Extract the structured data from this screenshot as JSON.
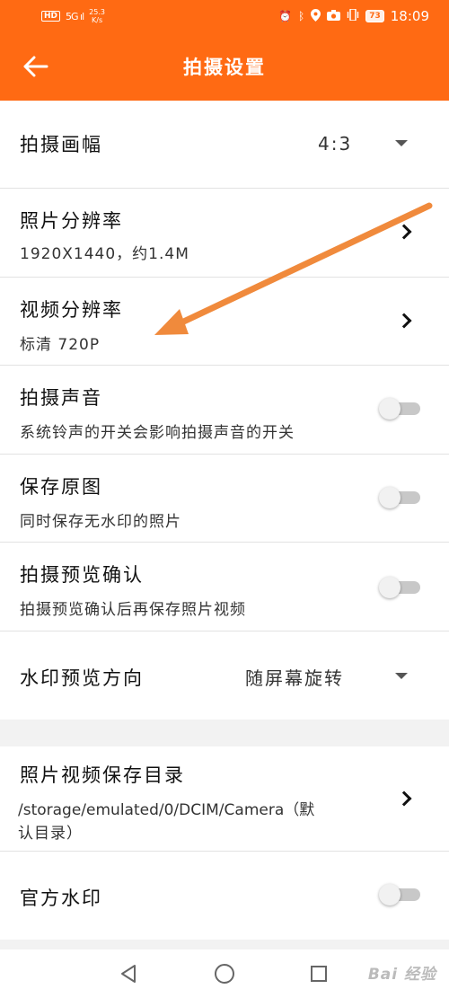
{
  "status_bar": {
    "hd": "HD",
    "signal": "5G ıl",
    "speed_value": "25.3",
    "speed_unit": "K/s",
    "icons_right": [
      "alarm-icon",
      "bluetooth-icon",
      "location-icon",
      "camera-icon",
      "vibrate-icon"
    ],
    "battery": "73",
    "time": "18:09"
  },
  "app_bar": {
    "title": "拍摄设置",
    "back_icon": "back-arrow-icon"
  },
  "settings": {
    "frame": {
      "title": "拍摄画幅",
      "value": "4:3"
    },
    "photo_resolution": {
      "title": "照片分辨率",
      "sub": "1920X1440，约1.4M"
    },
    "video_resolution": {
      "title": "视频分辨率",
      "sub": "标清 720P"
    },
    "shutter_sound": {
      "title": "拍摄声音",
      "sub": "系统铃声的开关会影响拍摄声音的开关",
      "on": false
    },
    "save_original": {
      "title": "保存原图",
      "sub": "同时保存无水印的照片",
      "on": false
    },
    "preview_confirm": {
      "title": "拍摄预览确认",
      "sub": "拍摄预览确认后再保存照片视频",
      "on": false
    },
    "watermark_direction": {
      "title": "水印预览方向",
      "value": "随屏幕旋转"
    },
    "save_directory": {
      "title": "照片视频保存目录",
      "sub_line1": "/storage/emulated/0/DCIM/Camera（默",
      "sub_line2": "认目录）"
    },
    "official_watermark": {
      "title": "官方水印",
      "on": false
    }
  },
  "colors": {
    "accent": "#ff6a13",
    "annotation_arrow": "#f08a3c"
  },
  "nav_bar": {
    "icons": [
      "back-triangle-icon",
      "home-circle-icon",
      "recents-square-icon"
    ]
  },
  "watermark": "Bai 经验"
}
